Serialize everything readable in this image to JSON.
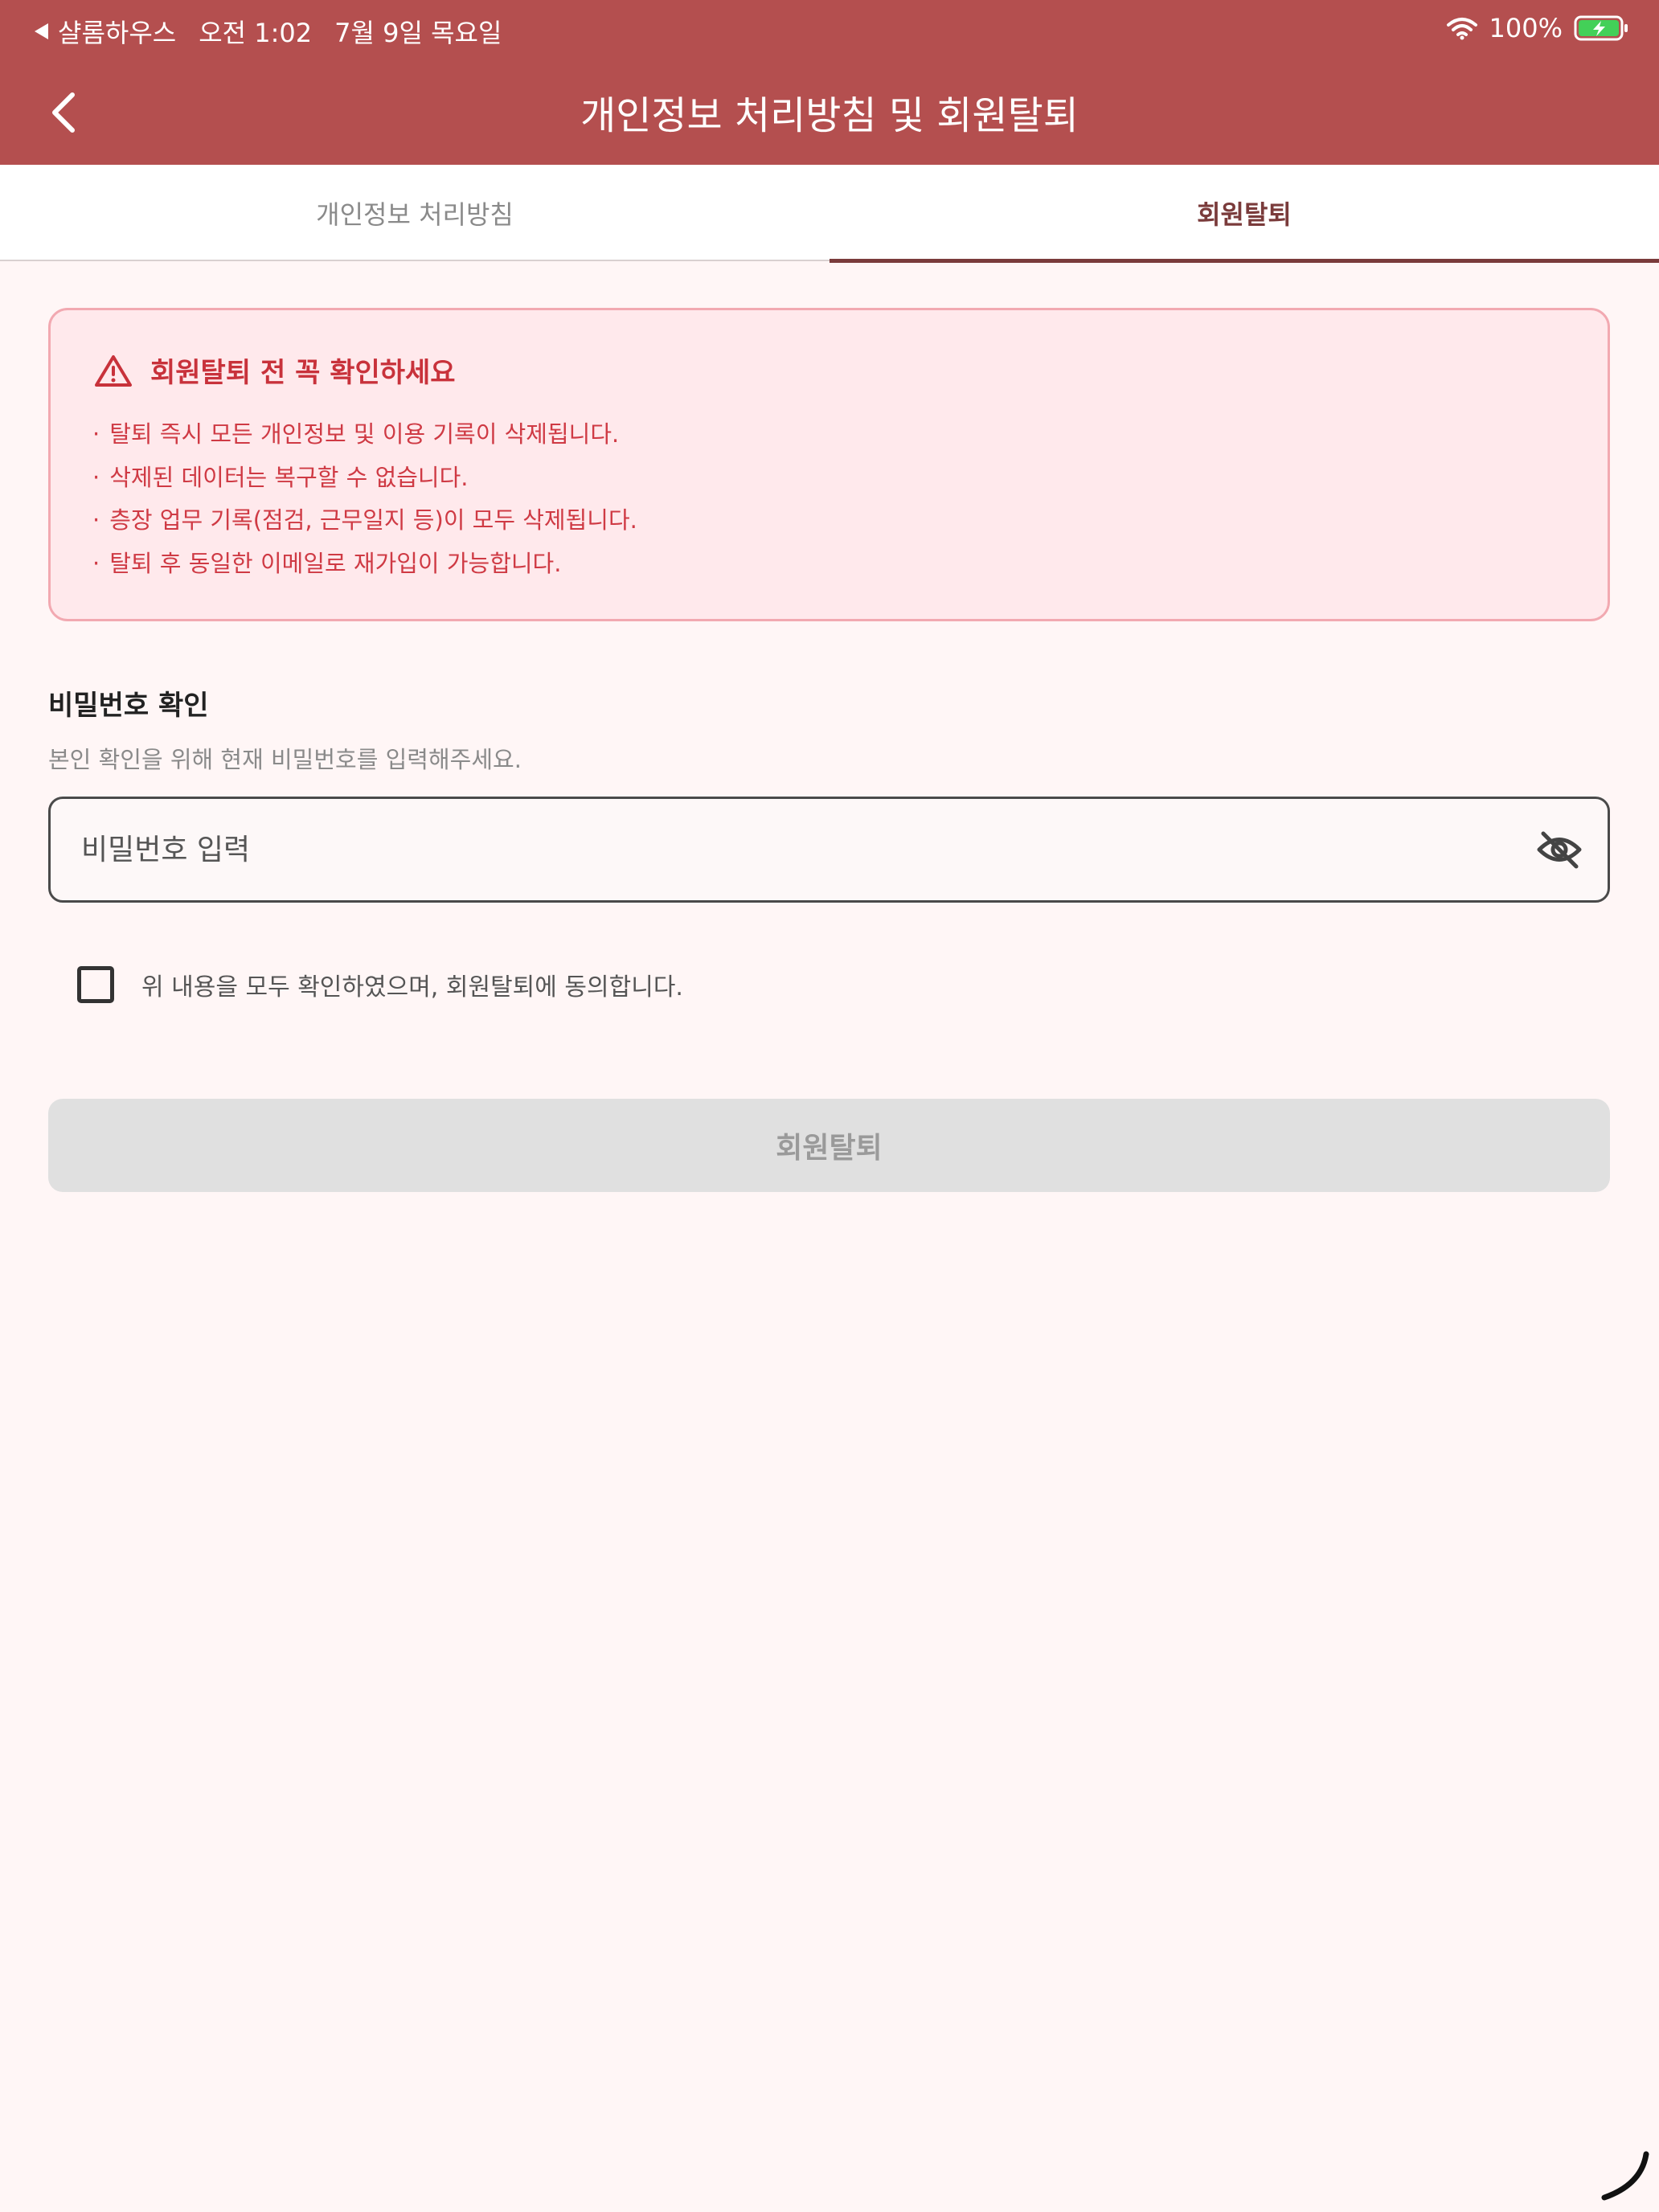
{
  "status_bar": {
    "back_app": "샬롬하우스",
    "time": "오전 1:02",
    "date": "7월 9일 목요일",
    "battery": "100%"
  },
  "header": {
    "title": "개인정보 처리방침 및 회원탈퇴"
  },
  "tabs": [
    {
      "label": "개인정보 처리방침",
      "active": false
    },
    {
      "label": "회원탈퇴",
      "active": true
    }
  ],
  "warning": {
    "title": "회원탈퇴 전 꼭 확인하세요",
    "items": [
      "탈퇴 즉시 모든 개인정보 및 이용 기록이 삭제됩니다.",
      "삭제된 데이터는 복구할 수 없습니다.",
      "층장 업무 기록(점검, 근무일지 등)이 모두 삭제됩니다.",
      "탈퇴 후 동일한 이메일로 재가입이 가능합니다."
    ]
  },
  "password": {
    "section_title": "비밀번호 확인",
    "description": "본인 확인을 위해 현재 비밀번호를 입력해주세요.",
    "placeholder": "비밀번호 입력",
    "value": ""
  },
  "agreement": {
    "label": "위 내용을 모두 확인하였으며, 회원탈퇴에 동의합니다.",
    "checked": false
  },
  "submit": {
    "label": "회원탈퇴",
    "enabled": false
  },
  "colors": {
    "primary": "#b44f4f",
    "background": "#fff6f6",
    "warning_text": "#cf3a44",
    "warning_bg": "#ffe9ec",
    "disabled": "#e0e0e0"
  }
}
